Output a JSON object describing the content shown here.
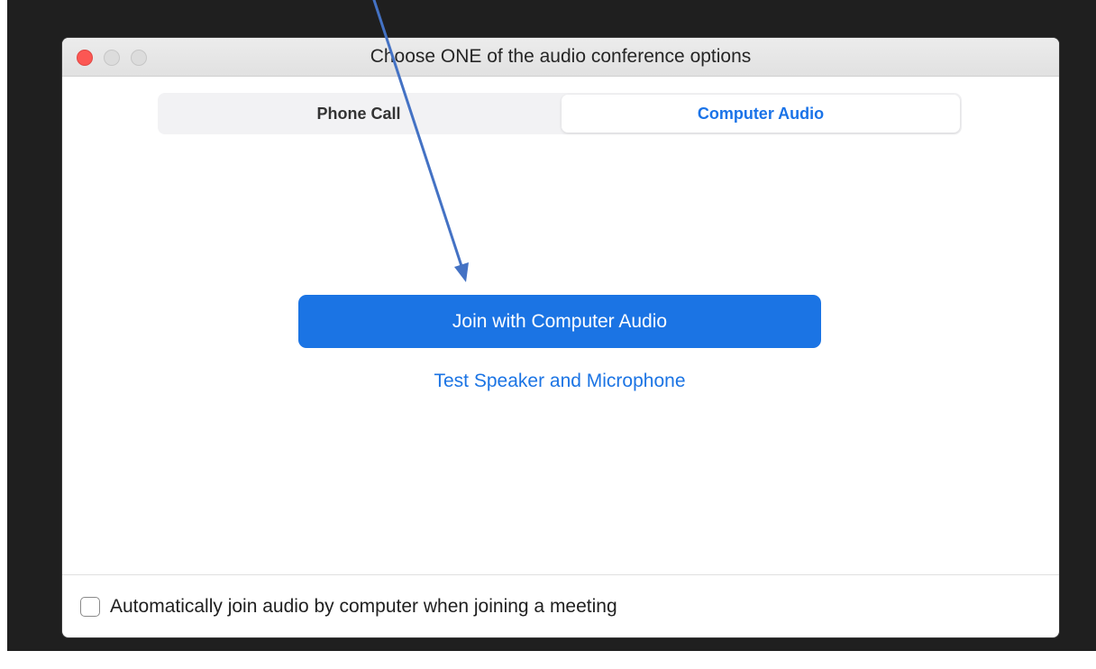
{
  "window": {
    "title": "Choose ONE of the audio conference options"
  },
  "tabs": [
    {
      "label": "Phone Call",
      "selected": false
    },
    {
      "label": "Computer Audio",
      "selected": true
    }
  ],
  "main": {
    "join_button_label": "Join with Computer Audio",
    "test_link_label": "Test Speaker and Microphone"
  },
  "footer": {
    "auto_join_label": "Automatically join audio by computer when joining a meeting",
    "auto_join_checked": false
  },
  "colors": {
    "accent": "#1b74e4",
    "close_button": "#fc5753",
    "annotation_arrow": "#4472c4"
  }
}
